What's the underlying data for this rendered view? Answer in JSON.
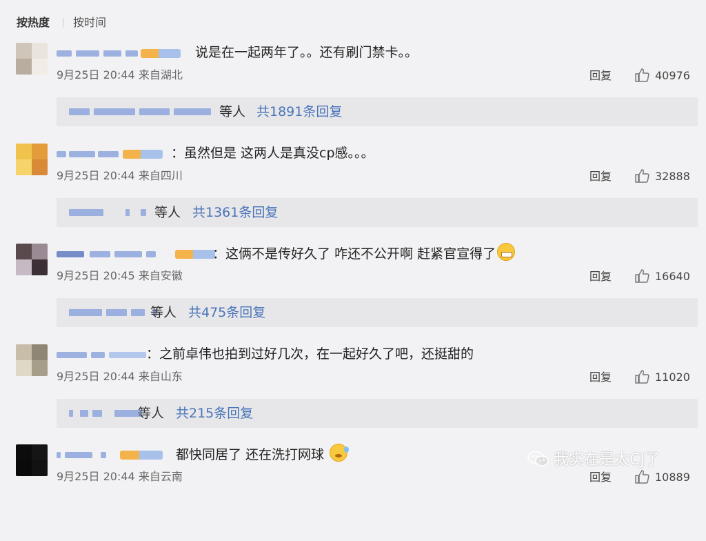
{
  "sort": {
    "hot": "按热度",
    "time": "按时间"
  },
  "comments": [
    {
      "text": "说是在一起两年了。。还有刷门禁卡。。",
      "emoji": "",
      "date": "9月25日 20:44",
      "location": "来自湖北",
      "reply_label": "回复",
      "likes": "40976",
      "reply_wait": "等人",
      "reply_total": "共1891条回复",
      "avatar_colors": [
        "#cfc5b8",
        "#e9e4dc",
        "#b9ad9f",
        "#f1ede6"
      ]
    },
    {
      "text": "：虽然但是 这两人是真没cp感。。。",
      "emoji": "",
      "date": "9月25日 20:44",
      "location": "来自四川",
      "reply_label": "回复",
      "likes": "32888",
      "reply_wait": "等人",
      "reply_total": "共1361条回复",
      "avatar_colors": [
        "#f0c44c",
        "#e49c3a",
        "#f6d46a",
        "#d88a36"
      ]
    },
    {
      "text": "：这俩不是传好久了 咋还不公开啊 赶紧官宣得了",
      "emoji": "grin",
      "date": "9月25日 20:45",
      "location": "来自安徽",
      "reply_label": "回复",
      "likes": "16640",
      "reply_wait": "等人",
      "reply_total": "共475条回复",
      "avatar_colors": [
        "#5a4a4e",
        "#9a8a93",
        "#c6b9c4",
        "#3c3036"
      ]
    },
    {
      "text": "：之前卓伟也拍到过好几次，在一起好久了吧，还挺甜的",
      "emoji": "",
      "date": "9月25日 20:44",
      "location": "来自山东",
      "reply_label": "回复",
      "likes": "11020",
      "reply_wait": "等人",
      "reply_total": "共215条回复",
      "avatar_colors": [
        "#c7bda8",
        "#8f8674",
        "#e0d8c6",
        "#a79e89"
      ]
    },
    {
      "text": "都快同居了 还在洗打网球",
      "emoji": "sleepy",
      "date": "9月25日 20:44",
      "location": "来自云南",
      "reply_label": "回复",
      "likes": "10889",
      "reply_wait": "",
      "reply_total": "",
      "avatar_colors": [
        "#0c0c0c",
        "#151515",
        "#0a0a0a",
        "#121212"
      ]
    }
  ],
  "watermark": {
    "text": "我实在是太CJ了"
  },
  "colors": {
    "link": "#4a74b8",
    "background": "#f2f2f4",
    "reply_box": "#e7e7ea"
  }
}
